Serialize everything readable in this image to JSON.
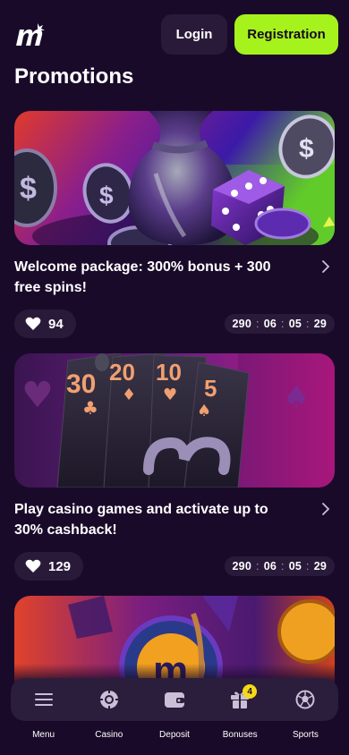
{
  "header": {
    "login_label": "Login",
    "registration_label": "Registration",
    "logo_icon": "m-logo"
  },
  "page_title": "Promotions",
  "promotions": [
    {
      "title": "Welcome package: 300% bonus + 300 free spins!",
      "likes": "94",
      "timer": [
        "290",
        "06",
        "05",
        "29"
      ],
      "image": "money-bag-dice-coins"
    },
    {
      "title": "Play casino games and activate up to 30% cashback!",
      "likes": "129",
      "timer": [
        "290",
        "06",
        "05",
        "29"
      ],
      "image": "cards-30-20-10-5"
    },
    {
      "image": "emblem-coins"
    }
  ],
  "nav": {
    "items": [
      {
        "label": "Menu",
        "icon": "menu-icon"
      },
      {
        "label": "Casino",
        "icon": "chip-icon"
      },
      {
        "label": "Deposit",
        "icon": "wallet-icon"
      },
      {
        "label": "Bonuses",
        "icon": "gift-icon",
        "badge": "4"
      },
      {
        "label": "Sports",
        "icon": "ball-icon"
      }
    ]
  },
  "colors": {
    "background": "#1a0a2a",
    "accent": "#a6f21c",
    "pill": "#2a1a3a",
    "badge": "#f4d81a"
  }
}
